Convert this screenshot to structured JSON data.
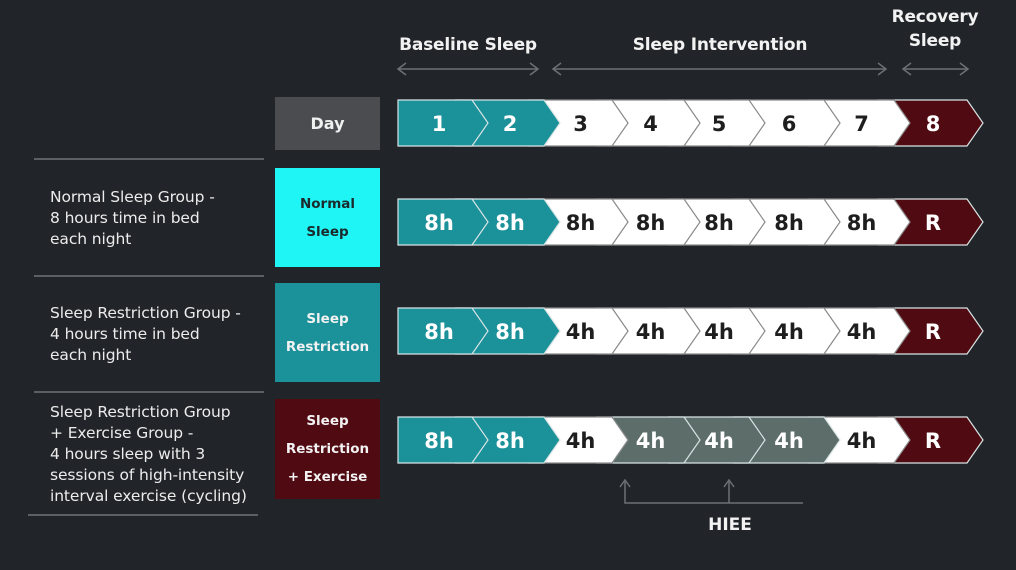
{
  "phases": [
    {
      "label": "Baseline Sleep",
      "days": [
        1,
        2
      ]
    },
    {
      "label": "Sleep Intervention",
      "days": [
        3,
        4,
        5,
        6,
        7
      ]
    },
    {
      "label": "Recovery\nSleep",
      "days": [
        8
      ]
    }
  ],
  "colors": {
    "background": "#212428",
    "baseline": "#1b9199",
    "intervention": "#ffffff",
    "recovery": "#500a12",
    "exercise": "#5d6d69",
    "day_box": "#4a4c50",
    "normal_box": "#1ff5f5",
    "restriction_box": "#1b9199",
    "exercise_box": "#500a12",
    "divider": "#5c5f63",
    "arrow": "#6d7175"
  },
  "header_row": {
    "label": "Day",
    "cells": [
      "1",
      "2",
      "3",
      "4",
      "5",
      "6",
      "7",
      "8"
    ],
    "types": [
      "baseline",
      "baseline",
      "intervention",
      "intervention",
      "intervention",
      "intervention",
      "intervention",
      "recovery"
    ]
  },
  "groups": [
    {
      "description": "Normal Sleep Group -\n8 hours time in bed\neach night",
      "label": "Normal\nSleep",
      "cells": [
        "8h",
        "8h",
        "8h",
        "8h",
        "8h",
        "8h",
        "8h",
        "R"
      ],
      "types": [
        "baseline",
        "baseline",
        "intervention",
        "intervention",
        "intervention",
        "intervention",
        "intervention",
        "recovery"
      ]
    },
    {
      "description": "Sleep Restriction Group -\n4 hours time in bed\neach night",
      "label": "Sleep\nRestriction",
      "cells": [
        "8h",
        "8h",
        "4h",
        "4h",
        "4h",
        "4h",
        "4h",
        "R"
      ],
      "types": [
        "baseline",
        "baseline",
        "intervention",
        "intervention",
        "intervention",
        "intervention",
        "intervention",
        "recovery"
      ]
    },
    {
      "description": "Sleep Restriction Group\n+ Exercise Group -\n4 hours sleep with 3\nsessions of high-intensity\ninterval exercise (cycling)",
      "label": "Sleep\nRestriction\n+ Exercise",
      "cells": [
        "8h",
        "8h",
        "4h",
        "4h",
        "4h",
        "4h",
        "4h",
        "R"
      ],
      "types": [
        "baseline",
        "baseline",
        "intervention",
        "exercise",
        "exercise",
        "exercise",
        "intervention",
        "recovery"
      ]
    }
  ],
  "annotation": {
    "label": "HIEE",
    "points_to_days": [
      4,
      5
    ]
  }
}
